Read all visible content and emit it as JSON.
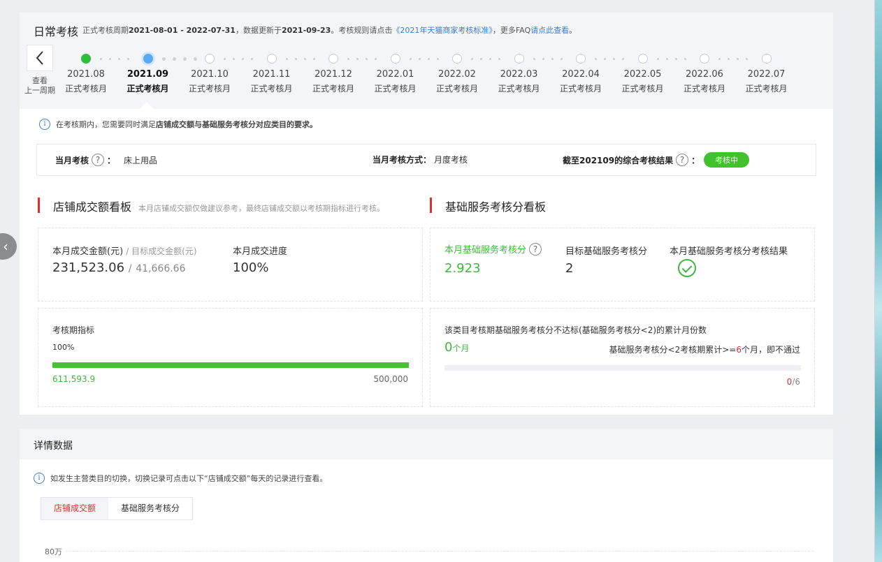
{
  "header": {
    "title": "日常考核",
    "period_prefix": "正式考核周期",
    "period_range": "2021-08-01 - 2022-07-31",
    "update_prefix": "，数据更新于",
    "update_date": "2021-09-23",
    "rule_prefix": "。考核规则请点击",
    "rule_link": "《2021年天猫商家考核标准》",
    "faq_prefix": "，更多FAQ",
    "faq_link": "请点此查看",
    "faq_suffix": "。"
  },
  "prev_period": {
    "label_line1": "查看",
    "label_line2": "上一周期",
    "icon": "chevron-left-icon"
  },
  "timeline": [
    {
      "month": "2021.08",
      "type": "正式考核月",
      "state": "done"
    },
    {
      "month": "2021.09",
      "type": "正式考核月",
      "state": "current"
    },
    {
      "month": "2021.10",
      "type": "正式考核月",
      "state": "pending"
    },
    {
      "month": "2021.11",
      "type": "正式考核月",
      "state": "pending"
    },
    {
      "month": "2021.12",
      "type": "正式考核月",
      "state": "pending"
    },
    {
      "month": "2022.01",
      "type": "正式考核月",
      "state": "pending"
    },
    {
      "month": "2022.02",
      "type": "正式考核月",
      "state": "pending"
    },
    {
      "month": "2022.03",
      "type": "正式考核月",
      "state": "pending"
    },
    {
      "month": "2022.04",
      "type": "正式考核月",
      "state": "pending"
    },
    {
      "month": "2022.05",
      "type": "正式考核月",
      "state": "pending"
    },
    {
      "month": "2022.06",
      "type": "正式考核月",
      "state": "pending"
    },
    {
      "month": "2022.07",
      "type": "正式考核月",
      "state": "pending"
    }
  ],
  "notice": {
    "pre": "在考核期内，您需要同时满足",
    "bold": "店铺成交额与基础服务考核分对应类目的要求。",
    "icon": "info-icon"
  },
  "summary": {
    "category_label": "当月考核",
    "category_value": "床上用品",
    "method_label": "当月考核方式：",
    "method_value": "月度考核",
    "result_label": "截至202109的综合考核结果",
    "result_status": "考核中",
    "colon": "："
  },
  "sales_board": {
    "title": "店铺成交额看板",
    "note": "本月店铺成交额仅做建议参考，最终店铺成交额以考核期指标进行考核。",
    "month_amount_label": "本月成交金额(元)",
    "target_amount_label": "/ 目标成交金额(元)",
    "month_amount": "231,523.06",
    "target_amount": "41,666.66",
    "progress_label": "本月成交进度",
    "progress_value": "100%",
    "period_label": "考核期指标",
    "period_percent": "100%",
    "period_progress_fraction": 1.0,
    "period_actual": "611,593.9",
    "period_target": "500,000"
  },
  "service_board": {
    "title": "基础服务考核分看板",
    "score_label": "本月基础服务考核分",
    "score_value": "2.923",
    "target_label": "目标基础服务考核分",
    "target_value": "2",
    "result_label": "本月基础服务考核分考核结果",
    "result_icon": "check-circle-icon",
    "fail_desc": "该类目考核期基础服务考核分不达标(基础服务考核分<2)的累计月份数",
    "fail_count": "0",
    "fail_unit": "个月",
    "rule_pre": "基础服务考核分<2考核期累计>=",
    "rule_num": "6",
    "rule_post": "个月，即不通过",
    "fail_ratio_num": "0",
    "fail_ratio_den": "/6",
    "fail_progress_fraction": 0.0
  },
  "details": {
    "title": "详情数据",
    "notice": "如发生主营类目的切换，切换记录可点击以下“店铺成交额”每天的记录进行查看。",
    "tabs": [
      "店铺成交额",
      "基础服务考核分"
    ],
    "active_tab": 0,
    "y_tick": "80万"
  },
  "colors": {
    "accent_red": "#e02e2e",
    "success_green": "#3fb73d",
    "current_blue": "#5aa9f5",
    "link_blue": "#3a7fd5"
  }
}
